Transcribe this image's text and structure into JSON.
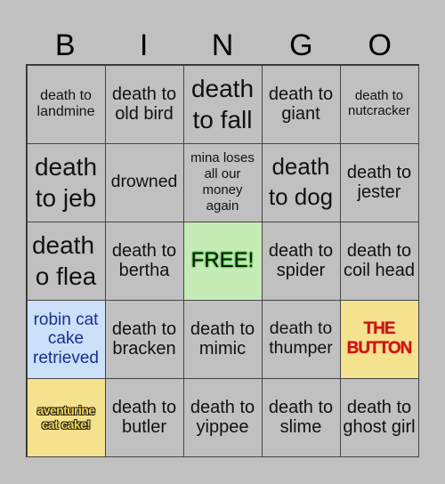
{
  "header": {
    "letters": [
      "B",
      "I",
      "N",
      "G",
      "O"
    ]
  },
  "card": {
    "cells": [
      "death to landmine",
      "death to old bird",
      "death to fall",
      "death to giant",
      "death to nutcracker",
      "death to jeb",
      "drowned",
      "mina loses all our money again",
      "death to dog",
      "death to jester",
      "death o flea",
      "death to bertha",
      "FREE!",
      "death to spider",
      "death to coil head",
      "robin cat cake retrieved",
      "death to bracken",
      "death to mimic",
      "death to thumper",
      "THE BUTTON",
      "aventurine cat cake!",
      "death to butler",
      "death to yippee",
      "death to slime",
      "death to ghost girl"
    ],
    "colors": {
      "default_cell": "#c0c0c0",
      "free_cell": "#c6ecb5",
      "robin_cell": "#cce0fa",
      "highlight_cell": "#f5e28f",
      "button_text": "#cc1414"
    }
  }
}
